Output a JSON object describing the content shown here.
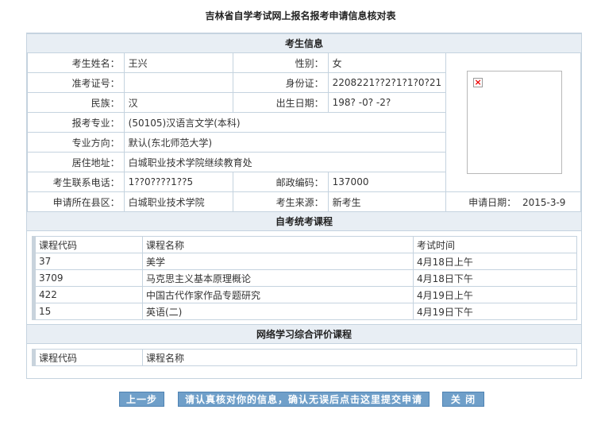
{
  "page_title": "吉林省自学考试网上报名报考申请信息核对表",
  "sections": {
    "student_info": "考生信息",
    "exam_courses": "自考统考课程",
    "online_courses": "网络学习综合评价课程"
  },
  "student": {
    "name_label": "考生姓名：",
    "name_value": "王兴",
    "gender_label": "性别：",
    "gender_value": "女",
    "ticket_label": "准考证号：",
    "ticket_value": "",
    "idcard_label": "身份证：",
    "idcard_value": "2208221??2?1?1?0?21",
    "ethnicity_label": "民族：",
    "ethnicity_value": "汉",
    "birth_label": "出生日期：",
    "birth_value": "198? -0? -2?",
    "major_label": "报考专业：",
    "major_value": "(50105)汉语言文学(本科)",
    "direction_label": "专业方向：",
    "direction_value": "默认(东北师范大学)",
    "address_label": "居住地址：",
    "address_value": "白城职业技术学院继续教育处",
    "phone_label": "考生联系电话：",
    "phone_value": "1??0????1??5",
    "postcode_label": "邮政编码：",
    "postcode_value": "137000",
    "county_label": "申请所在县区：",
    "county_value": "白城职业技术学院",
    "source_label": "考生来源：",
    "source_value": "新考生",
    "apply_date_label": "申请日期：",
    "apply_date_value": "2015-3-9"
  },
  "exam_courses": {
    "headers": [
      "课程代码",
      "课程名称",
      "考试时间"
    ],
    "rows": [
      [
        "37",
        "美学",
        "4月18日上午"
      ],
      [
        "3709",
        "马克思主义基本原理概论",
        "4月18日下午"
      ],
      [
        "422",
        "中国古代作家作品专题研究",
        "4月19日上午"
      ],
      [
        "15",
        "英语(二)",
        "4月19日下午"
      ]
    ]
  },
  "online_courses": {
    "headers": [
      "课程代码",
      "课程名称"
    ]
  },
  "buttons": {
    "prev": "上一步",
    "submit": "请认真核对你的信息，确认无误后点击这里提交申请",
    "close": "关 闭"
  },
  "icons": {
    "broken_image": "broken-image-icon"
  },
  "colors": {
    "button_bg": "#6f9fc9",
    "header_bg": "#e8eef4",
    "border": "#c5d3df"
  }
}
